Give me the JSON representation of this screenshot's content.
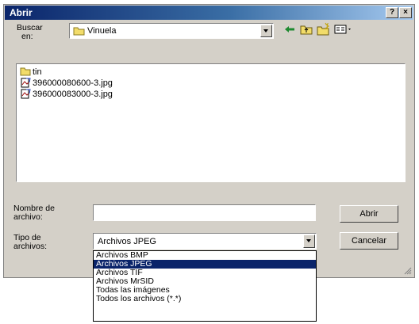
{
  "window": {
    "title": "Abrir",
    "help_glyph": "?",
    "close_glyph": "×"
  },
  "lookin": {
    "label_line1": "Buscar",
    "label_line2": "en:",
    "value": "Vinuela"
  },
  "files": [
    {
      "name": "tin",
      "icon": "folder-icon"
    },
    {
      "name": "396000080600-3.jpg",
      "icon": "image-file-icon"
    },
    {
      "name": "396000083000-3.jpg",
      "icon": "image-file-icon"
    }
  ],
  "filename": {
    "label_line1": "Nombre de",
    "label_line2": "archivo:",
    "value": ""
  },
  "filetype": {
    "label_line1": "Tipo de",
    "label_line2": "archivos:",
    "value": "Archivos JPEG",
    "options": [
      "Archivos BMP",
      "Archivos JPEG",
      "Archivos TIF",
      "Archivos MrSID",
      "Todas las imágenes",
      "Todos los archivos (*.*)"
    ],
    "selected_index": 1
  },
  "buttons": {
    "open": "Abrir",
    "cancel": "Cancelar"
  },
  "colors": {
    "title_bar": "#0a246a",
    "dialog_face": "#d4d0c8",
    "selection": "#0a246a"
  }
}
